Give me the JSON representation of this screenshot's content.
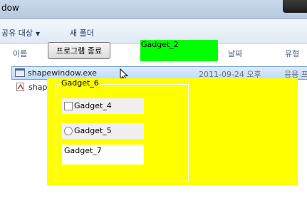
{
  "window": {
    "title_fragment": "dow"
  },
  "command_bar": {
    "share_label": "공유 대상",
    "new_folder_label": "새 폴더"
  },
  "columns": {
    "name": "이름",
    "date": "날짜",
    "type": "유형"
  },
  "files": [
    {
      "name": "shapewindow.exe",
      "date": "2011-09-24 오후",
      "type": "응용 프"
    },
    {
      "name": "shape"
    }
  ],
  "overlay": {
    "end_button_label": "프로그램 종료",
    "gadget2_label": "Gadget_2",
    "gadget6_label": "Gadget_6",
    "gadget4_label": "Gadget_4",
    "gadget5_label": "Gadget_5",
    "gadget7_value": "Gadget_7"
  },
  "colors": {
    "yellow_window": "#ffff00",
    "green_gadget": "#00ff00"
  }
}
